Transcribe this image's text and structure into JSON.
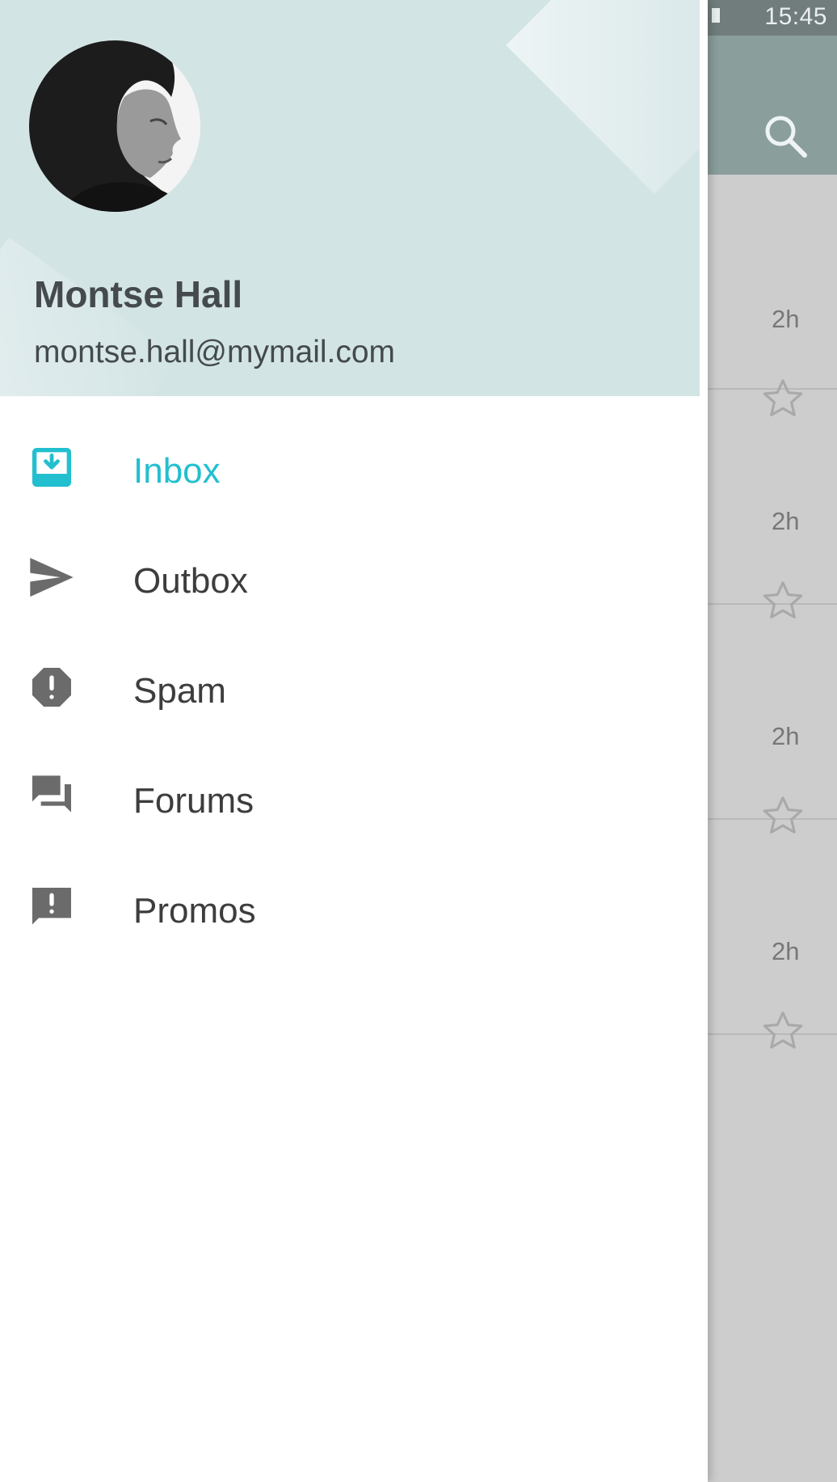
{
  "status_bar": {
    "time": "15:45"
  },
  "mail_list": {
    "items": [
      {
        "time": "2h"
      },
      {
        "time": "2h"
      },
      {
        "time": "2h"
      },
      {
        "time": "2h"
      }
    ]
  },
  "drawer": {
    "user": {
      "name": "Montse Hall",
      "email": "montse.hall@mymail.com"
    },
    "nav": [
      {
        "label": "Inbox",
        "icon": "inbox-icon",
        "active": true
      },
      {
        "label": "Outbox",
        "icon": "send-icon",
        "active": false
      },
      {
        "label": "Spam",
        "icon": "report-icon",
        "active": false
      },
      {
        "label": "Forums",
        "icon": "forum-icon",
        "active": false
      },
      {
        "label": "Promos",
        "icon": "announcement-icon",
        "active": false
      }
    ]
  },
  "colors": {
    "accent": "#22bfcf",
    "header_bg": "#d3e4e5",
    "app_bar": "#8a9e9c",
    "icon_gray": "#6b6b6b"
  }
}
